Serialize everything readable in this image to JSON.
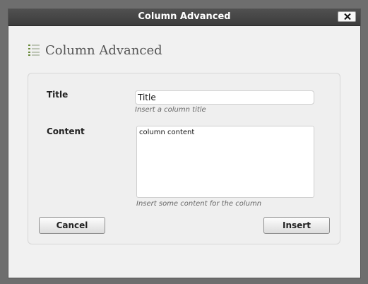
{
  "window": {
    "title": "Column Advanced"
  },
  "header": {
    "title": "Column Advanced",
    "icon": "list-icon"
  },
  "form": {
    "title_label": "Title",
    "title_value": "Title",
    "title_hint": "Insert a column title",
    "content_label": "Content",
    "content_value": "column content",
    "content_hint": "Insert some content for the column"
  },
  "buttons": {
    "cancel_label": "Cancel",
    "insert_label": "Insert"
  },
  "colors": {
    "titlebar": "#444444",
    "icon_accent": "#6a8a3a"
  }
}
